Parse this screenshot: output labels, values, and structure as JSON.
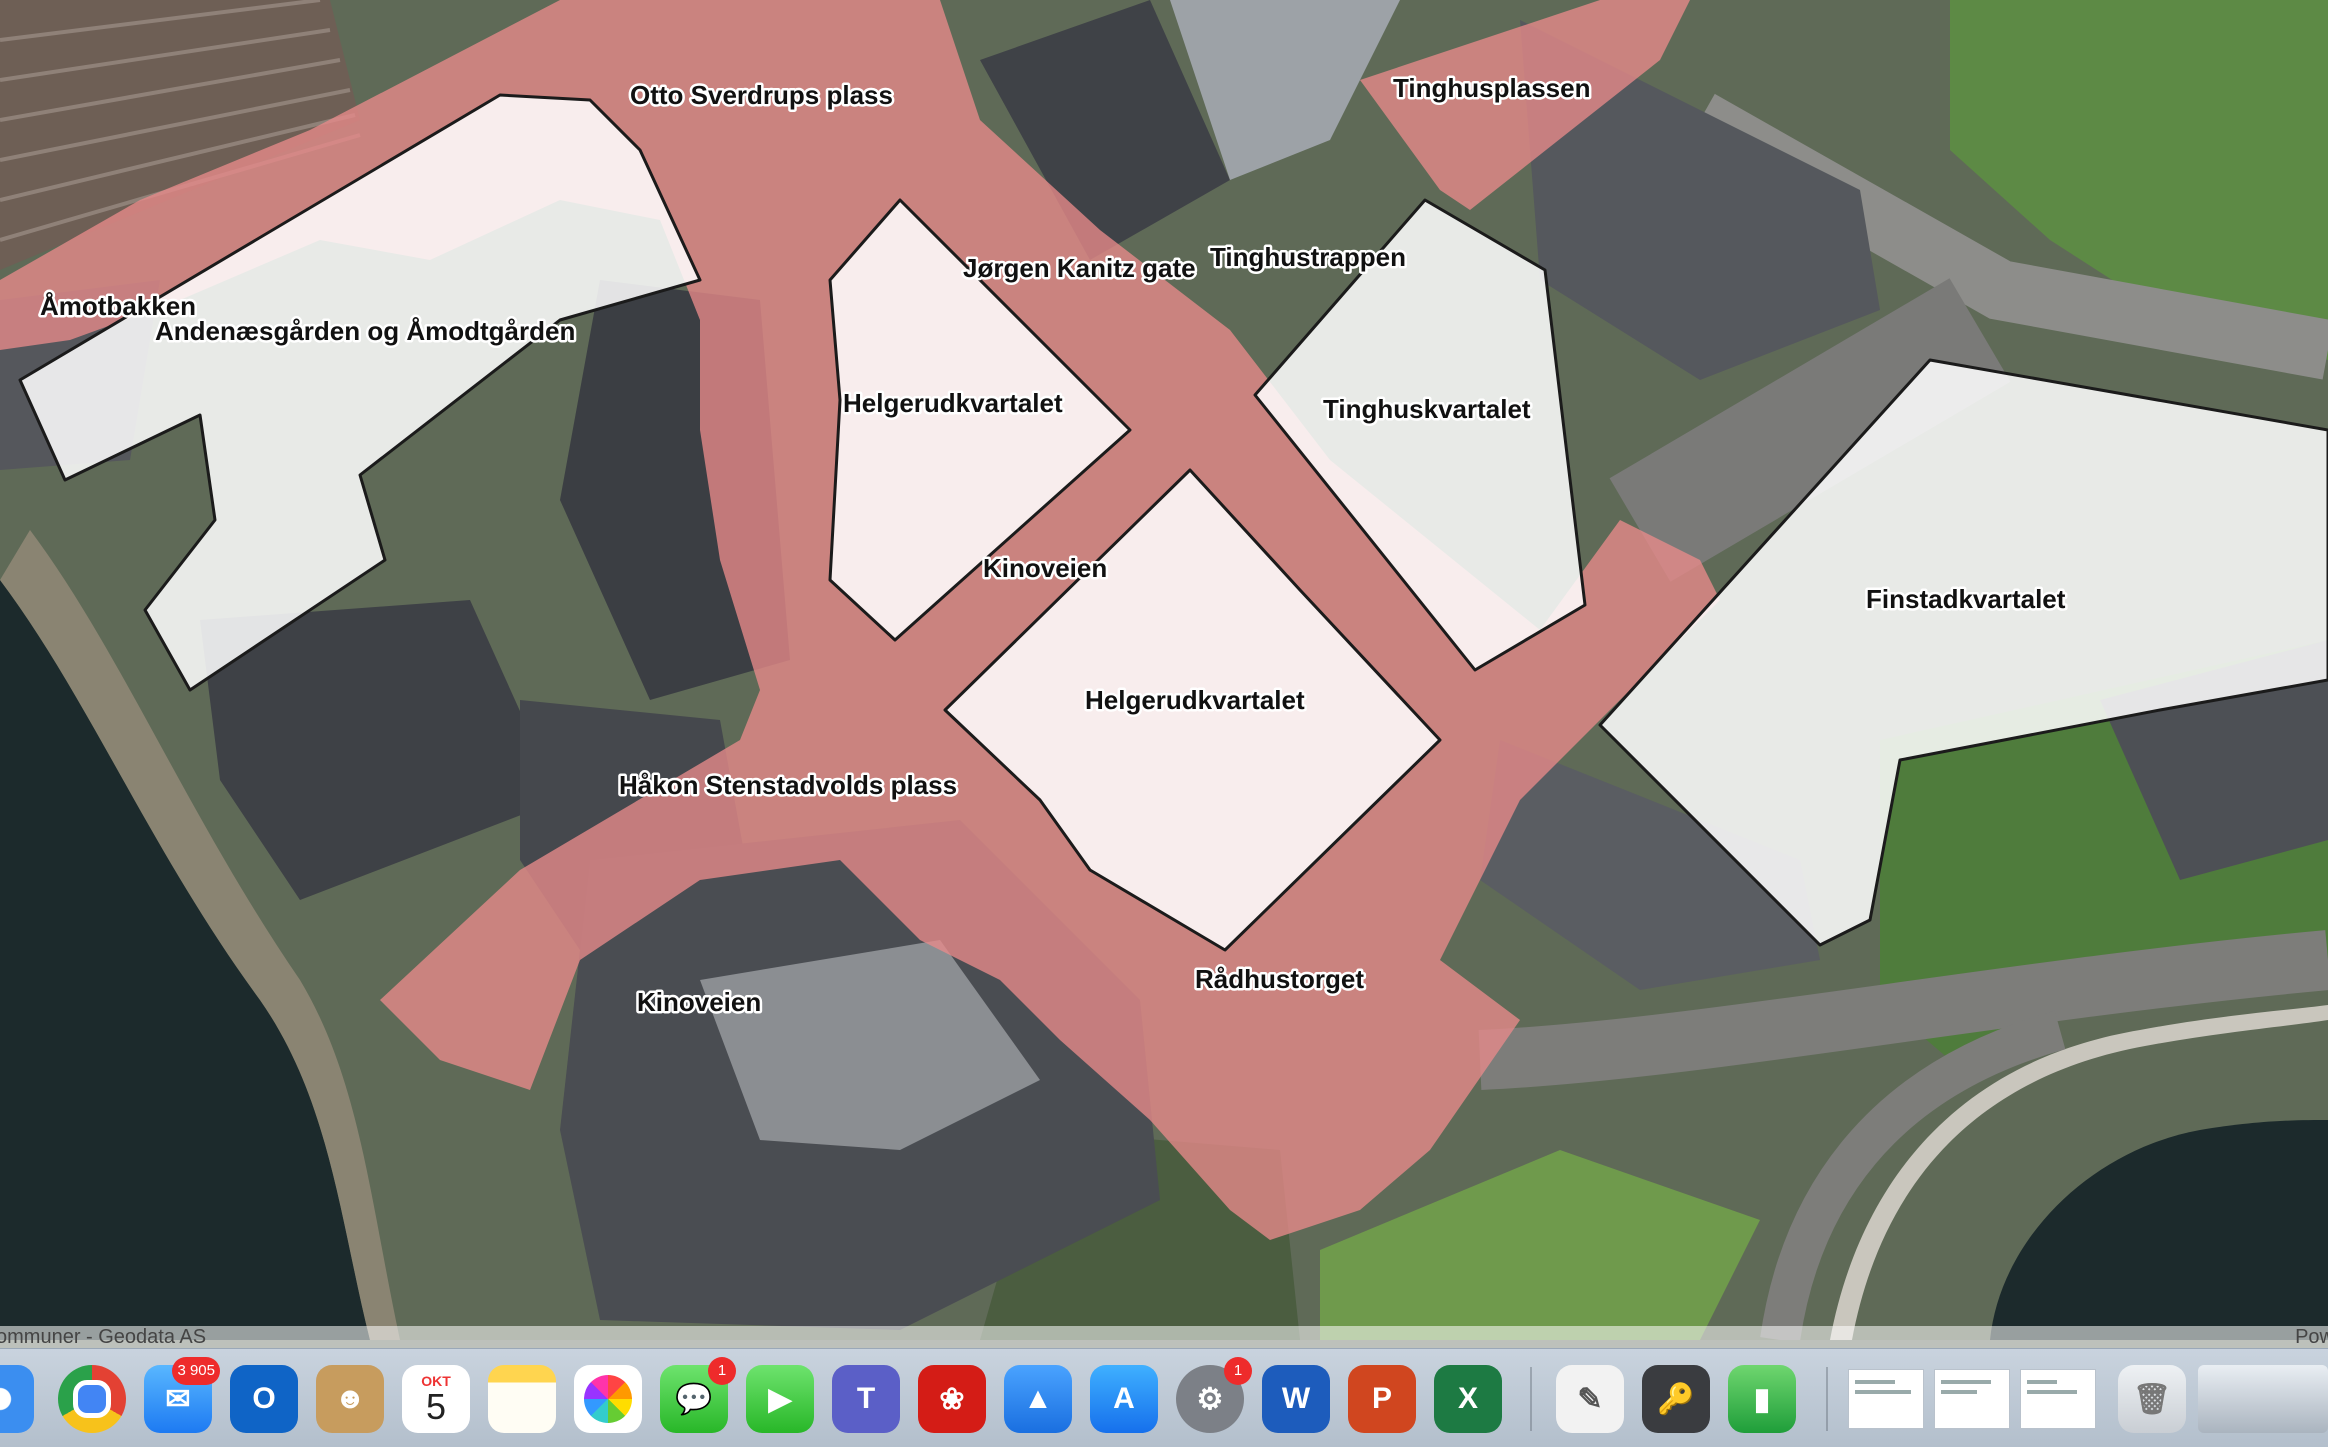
{
  "map": {
    "labels": {
      "otto": "Otto Sverdrups plass",
      "tinghusplassen": "Tinghusplassen",
      "amotbakken": "Åmotbakken",
      "andenaes": "Andenæsgården og Åmodtgården",
      "jorgen": "Jørgen Kanitz gate",
      "tinghustrappen": "Tinghustrappen",
      "helgerud1": "Helgerudkvartalet",
      "tinghuskvartalet": "Tinghuskvartalet",
      "kinoveien1": "Kinoveien",
      "finstad": "Finstadkvartalet",
      "helgerud2": "Helgerudkvartalet",
      "haakon": "Håkon Stenstadvolds plass",
      "kinoveien2": "Kinoveien",
      "radhustorget": "Rådhustorget"
    },
    "attribution_left": "ommuner - Geodata AS",
    "attribution_right": "Pow"
  },
  "dock": {
    "mail_badge": "3 905",
    "calendar_month": "OKT",
    "calendar_day": "5",
    "messages_badge": "1",
    "settings_badge": "1"
  },
  "colors": {
    "street_overlay": "#e88a8a",
    "block_fill": "#ffffff",
    "block_stroke": "#1b1b1b"
  }
}
